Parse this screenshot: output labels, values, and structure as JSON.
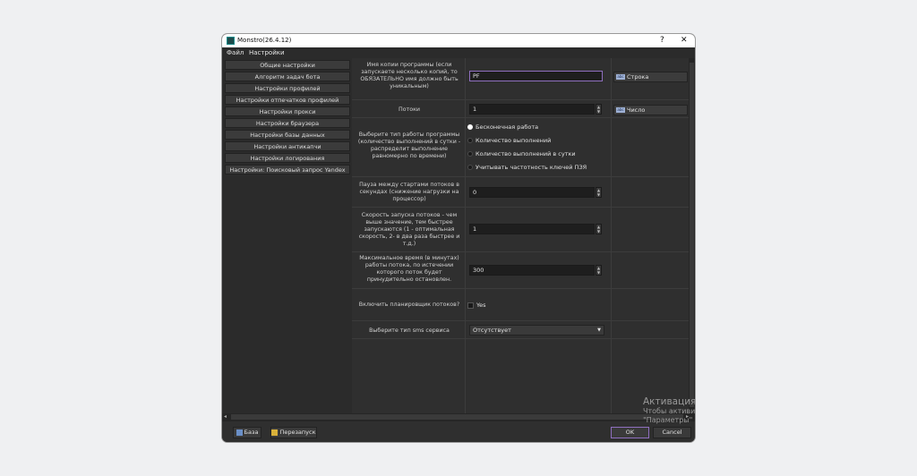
{
  "window": {
    "title": "Monstro(26.4.12)",
    "help": "?",
    "close": "✕"
  },
  "menu": [
    "Файл",
    "Настройки"
  ],
  "sidebar": {
    "items": [
      "Общие настройки",
      "Алгоритм задач бота",
      "Настройки профилей",
      "Настройки отпечатков профилей",
      "Настройки прокси",
      "Настройки браузера",
      "Настройки базы данных",
      "Настройки антикапчи",
      "Настройки логирования",
      "Настройки: Поисковый запрос Yandex"
    ]
  },
  "settings": {
    "copy_name": {
      "label": "Имя копии программы (если запускаете несколько копий, то ОБЯЗАТЕЛЬНО имя должно быть уникальным)",
      "value": "PF",
      "type": "Строка"
    },
    "threads": {
      "label": "Потоки",
      "value": "1",
      "type": "Число"
    },
    "work_type": {
      "label": "Выберите тип работы программы (количество выполнений в сутки - распределит выполнение равномерно по времени)",
      "options": [
        "Бесконечная работа",
        "Количество выполнений",
        "Количество выполнений в сутки",
        "Учитывать частотность ключей ПЗЯ"
      ],
      "selected": 0
    },
    "pause": {
      "label": "Пауза между стартами потоков в секундах (снижение нагрузки на процессор)",
      "value": "0"
    },
    "speed": {
      "label": "Скорость запуска потоков - чем выше значение, тем быстрее запускаются (1 - оптимальная скорость, 2- в два раза быстрее и т.д.)",
      "value": "1"
    },
    "max_time": {
      "label": "Максимальное время (в минутах) работы потока, по истечении которого поток будет принудительно остановлен.",
      "value": "300"
    },
    "scheduler": {
      "label": "Включить планировщик потоков?",
      "checkbox_label": "Yes",
      "checked": false
    },
    "sms": {
      "label": "Выберите тип sms сервиса",
      "value": "Отсутствует"
    }
  },
  "bottom": {
    "base": "База",
    "restart": "Перезапуск",
    "ok": "OK",
    "cancel": "Cancel"
  },
  "watermark": {
    "line1": "Активация",
    "line2": "Чтобы активи",
    "line3": "\"Параметры\""
  },
  "colors": {
    "background": "#2f2f2f",
    "focus": "#8f6fbf"
  }
}
